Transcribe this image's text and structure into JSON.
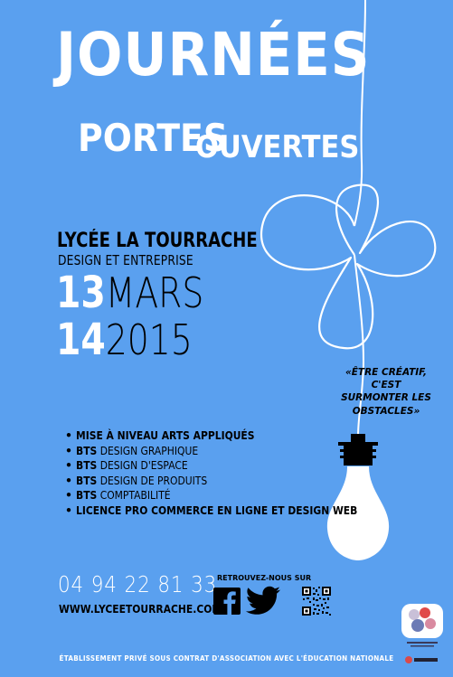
{
  "title": {
    "line1": "JOURNÉES",
    "portes": "PORTES",
    "ouvertes": "OUVERTES"
  },
  "school": {
    "name": "LYCÉE LA TOURRACHE",
    "subtitle": "DESIGN ET ENTREPRISE"
  },
  "dates": {
    "day1": "13",
    "month": "MARS",
    "day2": "14",
    "year": "2015"
  },
  "quote": "«ÊTRE CRÉATIF, C'EST SURMONTER LES OBSTACLES»",
  "programs": [
    {
      "bold": "MISE À NIVEAU ARTS APPLIQUÉS",
      "rest": ""
    },
    {
      "bold": "BTS",
      "rest": " DESIGN GRAPHIQUE"
    },
    {
      "bold": "BTS",
      "rest": " DESIGN D'ESPACE"
    },
    {
      "bold": "BTS",
      "rest": " DESIGN DE PRODUITS"
    },
    {
      "bold": "BTS",
      "rest": " COMPTABILITÉ"
    },
    {
      "bold": "LICENCE PRO COMMERCE EN LIGNE ET DESIGN WEB",
      "rest": ""
    }
  ],
  "contact": {
    "phone": "04 94 22 81 33",
    "website": "WWW.LYCEETOURRACHE.COM",
    "social_label": "RETROUVEZ-NOUS SUR"
  },
  "icons": {
    "facebook": "facebook-icon",
    "twitter": "twitter-icon",
    "qr": "qr-code-icon",
    "bulb": "light-bulb-illustration"
  },
  "footer": "ÉTABLISSEMENT PRIVÉ SOUS CONTRAT D'ASSOCIATION AVEC L'ÉDUCATION NATIONALE",
  "colors": {
    "background": "#5aa0ef",
    "text_dark": "#000000",
    "text_light": "#ffffff"
  }
}
